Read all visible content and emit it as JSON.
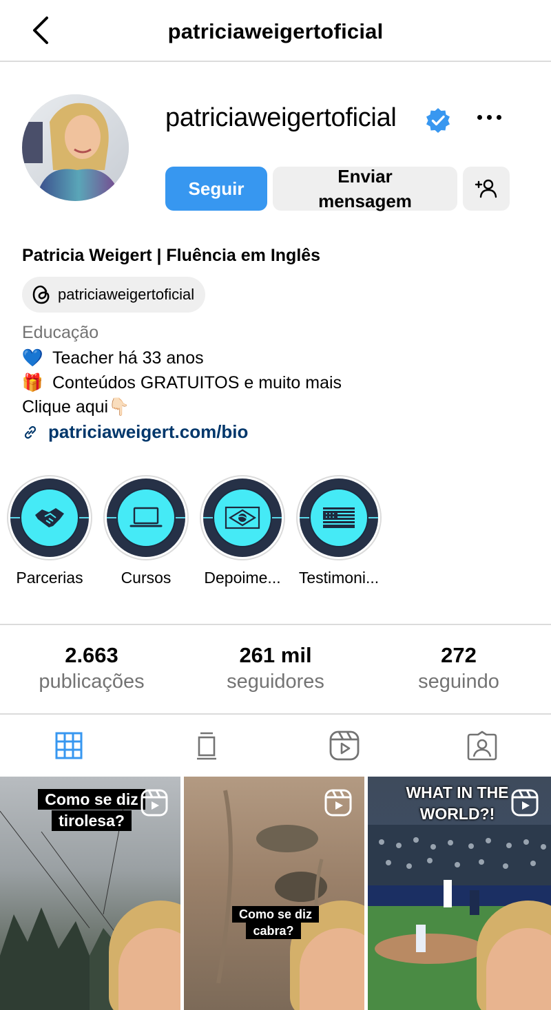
{
  "header": {
    "title": "patriciaweigertoficial",
    "back_icon": "chevron-left-icon"
  },
  "profile": {
    "username": "patriciaweigertoficial",
    "verified": true,
    "follow_label": "Seguir",
    "message_label_line1": "Enviar",
    "message_label_line2": "mensagem",
    "full_name": "Patricia Weigert | Fluência em Inglês",
    "threads_handle": "patriciaweigertoficial",
    "category": "Educação",
    "bio": [
      {
        "emoji": "💙",
        "text": "Teacher há 33 anos"
      },
      {
        "emoji": "🎁",
        "text": "Conteúdos GRATUITOS e muito mais"
      }
    ],
    "bio_cta": "Clique aqui👇🏻",
    "link": "patriciaweigert.com/bio"
  },
  "highlights": [
    {
      "label": "Parcerias",
      "icon": "handshake-icon"
    },
    {
      "label": "Cursos",
      "icon": "laptop-icon"
    },
    {
      "label": "Depoime...",
      "icon": "brazil-flag-icon"
    },
    {
      "label": "Testimoni...",
      "icon": "usa-flag-icon"
    }
  ],
  "stats": {
    "posts": {
      "value": "2.663",
      "label": "publicações"
    },
    "followers": {
      "value": "261 mil",
      "label": "seguidores"
    },
    "following": {
      "value": "272",
      "label": "seguindo"
    }
  },
  "tabs": [
    {
      "name": "posts",
      "icon": "grid-icon",
      "active": true
    },
    {
      "name": "guides",
      "icon": "guide-icon",
      "active": false
    },
    {
      "name": "reels",
      "icon": "reels-icon",
      "active": false
    },
    {
      "name": "tagged",
      "icon": "tagged-icon",
      "active": false
    }
  ],
  "posts": [
    {
      "caption": "Como se diz tirolesa?",
      "type": "reel"
    },
    {
      "caption": "Como se diz cabra?",
      "type": "reel"
    },
    {
      "caption": "WHAT IN THE WORLD?!",
      "type": "reel"
    }
  ],
  "colors": {
    "accent": "#3797f0",
    "link": "#00376b",
    "muted": "#737373",
    "verified": "#3897f0",
    "highlight_bg": "#263147",
    "highlight_circle": "#45eaf6"
  }
}
